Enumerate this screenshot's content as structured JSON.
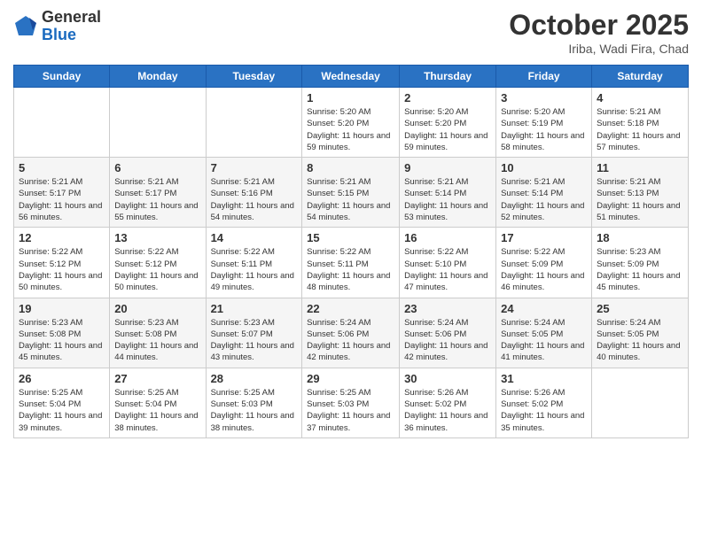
{
  "logo": {
    "general": "General",
    "blue": "Blue"
  },
  "header": {
    "month": "October 2025",
    "location": "Iriba, Wadi Fira, Chad"
  },
  "days_of_week": [
    "Sunday",
    "Monday",
    "Tuesday",
    "Wednesday",
    "Thursday",
    "Friday",
    "Saturday"
  ],
  "weeks": [
    [
      {
        "day": "",
        "info": ""
      },
      {
        "day": "",
        "info": ""
      },
      {
        "day": "",
        "info": ""
      },
      {
        "day": "1",
        "info": "Sunrise: 5:20 AM\nSunset: 5:20 PM\nDaylight: 11 hours and 59 minutes."
      },
      {
        "day": "2",
        "info": "Sunrise: 5:20 AM\nSunset: 5:20 PM\nDaylight: 11 hours and 59 minutes."
      },
      {
        "day": "3",
        "info": "Sunrise: 5:20 AM\nSunset: 5:19 PM\nDaylight: 11 hours and 58 minutes."
      },
      {
        "day": "4",
        "info": "Sunrise: 5:21 AM\nSunset: 5:18 PM\nDaylight: 11 hours and 57 minutes."
      }
    ],
    [
      {
        "day": "5",
        "info": "Sunrise: 5:21 AM\nSunset: 5:17 PM\nDaylight: 11 hours and 56 minutes."
      },
      {
        "day": "6",
        "info": "Sunrise: 5:21 AM\nSunset: 5:17 PM\nDaylight: 11 hours and 55 minutes."
      },
      {
        "day": "7",
        "info": "Sunrise: 5:21 AM\nSunset: 5:16 PM\nDaylight: 11 hours and 54 minutes."
      },
      {
        "day": "8",
        "info": "Sunrise: 5:21 AM\nSunset: 5:15 PM\nDaylight: 11 hours and 54 minutes."
      },
      {
        "day": "9",
        "info": "Sunrise: 5:21 AM\nSunset: 5:14 PM\nDaylight: 11 hours and 53 minutes."
      },
      {
        "day": "10",
        "info": "Sunrise: 5:21 AM\nSunset: 5:14 PM\nDaylight: 11 hours and 52 minutes."
      },
      {
        "day": "11",
        "info": "Sunrise: 5:21 AM\nSunset: 5:13 PM\nDaylight: 11 hours and 51 minutes."
      }
    ],
    [
      {
        "day": "12",
        "info": "Sunrise: 5:22 AM\nSunset: 5:12 PM\nDaylight: 11 hours and 50 minutes."
      },
      {
        "day": "13",
        "info": "Sunrise: 5:22 AM\nSunset: 5:12 PM\nDaylight: 11 hours and 50 minutes."
      },
      {
        "day": "14",
        "info": "Sunrise: 5:22 AM\nSunset: 5:11 PM\nDaylight: 11 hours and 49 minutes."
      },
      {
        "day": "15",
        "info": "Sunrise: 5:22 AM\nSunset: 5:11 PM\nDaylight: 11 hours and 48 minutes."
      },
      {
        "day": "16",
        "info": "Sunrise: 5:22 AM\nSunset: 5:10 PM\nDaylight: 11 hours and 47 minutes."
      },
      {
        "day": "17",
        "info": "Sunrise: 5:22 AM\nSunset: 5:09 PM\nDaylight: 11 hours and 46 minutes."
      },
      {
        "day": "18",
        "info": "Sunrise: 5:23 AM\nSunset: 5:09 PM\nDaylight: 11 hours and 45 minutes."
      }
    ],
    [
      {
        "day": "19",
        "info": "Sunrise: 5:23 AM\nSunset: 5:08 PM\nDaylight: 11 hours and 45 minutes."
      },
      {
        "day": "20",
        "info": "Sunrise: 5:23 AM\nSunset: 5:08 PM\nDaylight: 11 hours and 44 minutes."
      },
      {
        "day": "21",
        "info": "Sunrise: 5:23 AM\nSunset: 5:07 PM\nDaylight: 11 hours and 43 minutes."
      },
      {
        "day": "22",
        "info": "Sunrise: 5:24 AM\nSunset: 5:06 PM\nDaylight: 11 hours and 42 minutes."
      },
      {
        "day": "23",
        "info": "Sunrise: 5:24 AM\nSunset: 5:06 PM\nDaylight: 11 hours and 42 minutes."
      },
      {
        "day": "24",
        "info": "Sunrise: 5:24 AM\nSunset: 5:05 PM\nDaylight: 11 hours and 41 minutes."
      },
      {
        "day": "25",
        "info": "Sunrise: 5:24 AM\nSunset: 5:05 PM\nDaylight: 11 hours and 40 minutes."
      }
    ],
    [
      {
        "day": "26",
        "info": "Sunrise: 5:25 AM\nSunset: 5:04 PM\nDaylight: 11 hours and 39 minutes."
      },
      {
        "day": "27",
        "info": "Sunrise: 5:25 AM\nSunset: 5:04 PM\nDaylight: 11 hours and 38 minutes."
      },
      {
        "day": "28",
        "info": "Sunrise: 5:25 AM\nSunset: 5:03 PM\nDaylight: 11 hours and 38 minutes."
      },
      {
        "day": "29",
        "info": "Sunrise: 5:25 AM\nSunset: 5:03 PM\nDaylight: 11 hours and 37 minutes."
      },
      {
        "day": "30",
        "info": "Sunrise: 5:26 AM\nSunset: 5:02 PM\nDaylight: 11 hours and 36 minutes."
      },
      {
        "day": "31",
        "info": "Sunrise: 5:26 AM\nSunset: 5:02 PM\nDaylight: 11 hours and 35 minutes."
      },
      {
        "day": "",
        "info": ""
      }
    ]
  ]
}
